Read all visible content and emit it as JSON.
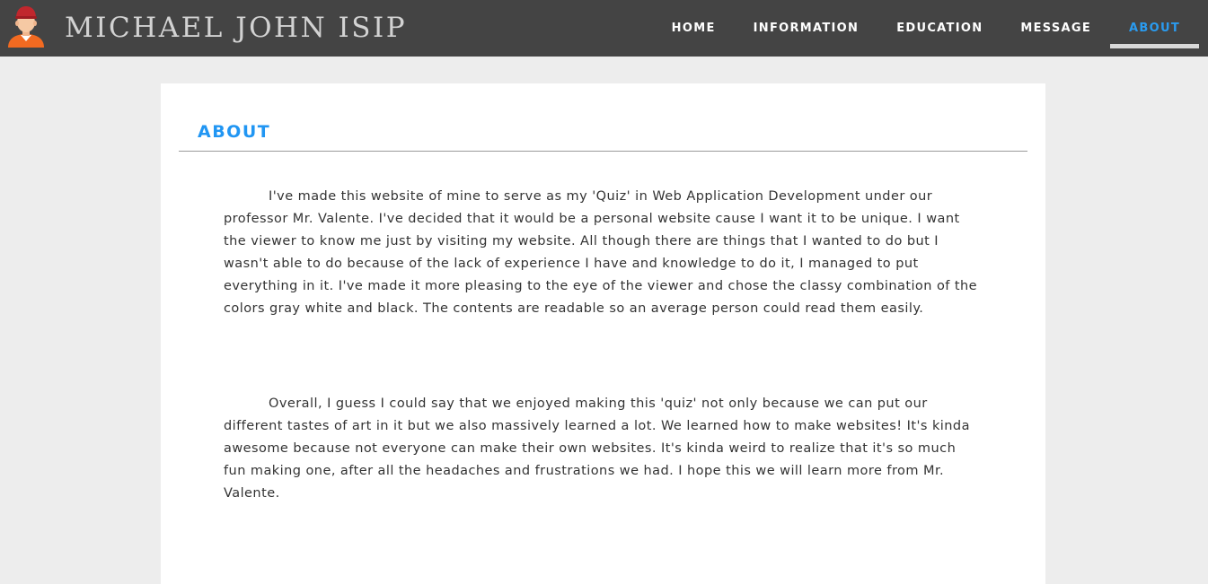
{
  "header": {
    "site_title": "MICHAEL JOHN ISIP",
    "avatar_icon": "person-avatar-icon",
    "background_color": "#444444",
    "nav": [
      {
        "label": "HOME",
        "active": false
      },
      {
        "label": "INFORMATION",
        "active": false
      },
      {
        "label": "EDUCATION",
        "active": false
      },
      {
        "label": "MESSAGE",
        "active": false
      },
      {
        "label": "ABOUT",
        "active": true
      }
    ],
    "active_color": "#2a9bef"
  },
  "main": {
    "section_title": "ABOUT",
    "paragraphs": [
      "I've made this website of mine to serve as my 'Quiz' in Web Application Development under our professor Mr. Valente. I've decided that it would be a personal website cause I want it to be unique. I want the viewer to know me just by visiting my website. All though there are things that I wanted to do but I wasn't able to do because of the lack of experience I have and knowledge to do it, I managed to put everything in it. I've made it more pleasing to the eye of the viewer and chose the classy combination of the colors gray white and black. The contents are readable so an average person could read them easily.",
      "Overall, I guess I could say that we enjoyed making this 'quiz' not only because we can put our different tastes of art in it but we also massively learned a lot. We learned how to make websites! It's kinda awesome because not everyone can make their own websites. It's kinda weird to realize that it's so much fun making one, after all the headaches and frustrations we had. I hope this we will learn more from Mr. Valente."
    ]
  }
}
